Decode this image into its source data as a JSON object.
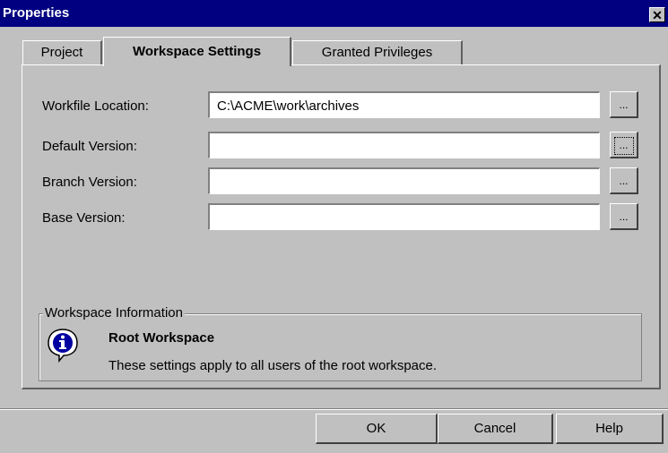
{
  "window": {
    "title": "Properties",
    "close_label": "✕"
  },
  "tabs": [
    {
      "label": "Project"
    },
    {
      "label": "Workspace Settings",
      "selected": true
    },
    {
      "label": "Granted Privileges"
    }
  ],
  "form": {
    "workfile_location": {
      "label": "Workfile Location:",
      "value": "C:\\ACME\\work\\archives"
    },
    "default_version": {
      "label": "Default Version:",
      "value": ""
    },
    "branch_version": {
      "label": "Branch Version:",
      "value": ""
    },
    "base_version": {
      "label": "Base Version:",
      "value": ""
    },
    "browse_label": "..."
  },
  "info_group": {
    "legend": "Workspace Information",
    "title": "Root Workspace",
    "text": "These settings apply to all users of the root workspace.",
    "icon": "info-icon"
  },
  "buttons": {
    "ok": "OK",
    "cancel": "Cancel",
    "help": "Help"
  }
}
